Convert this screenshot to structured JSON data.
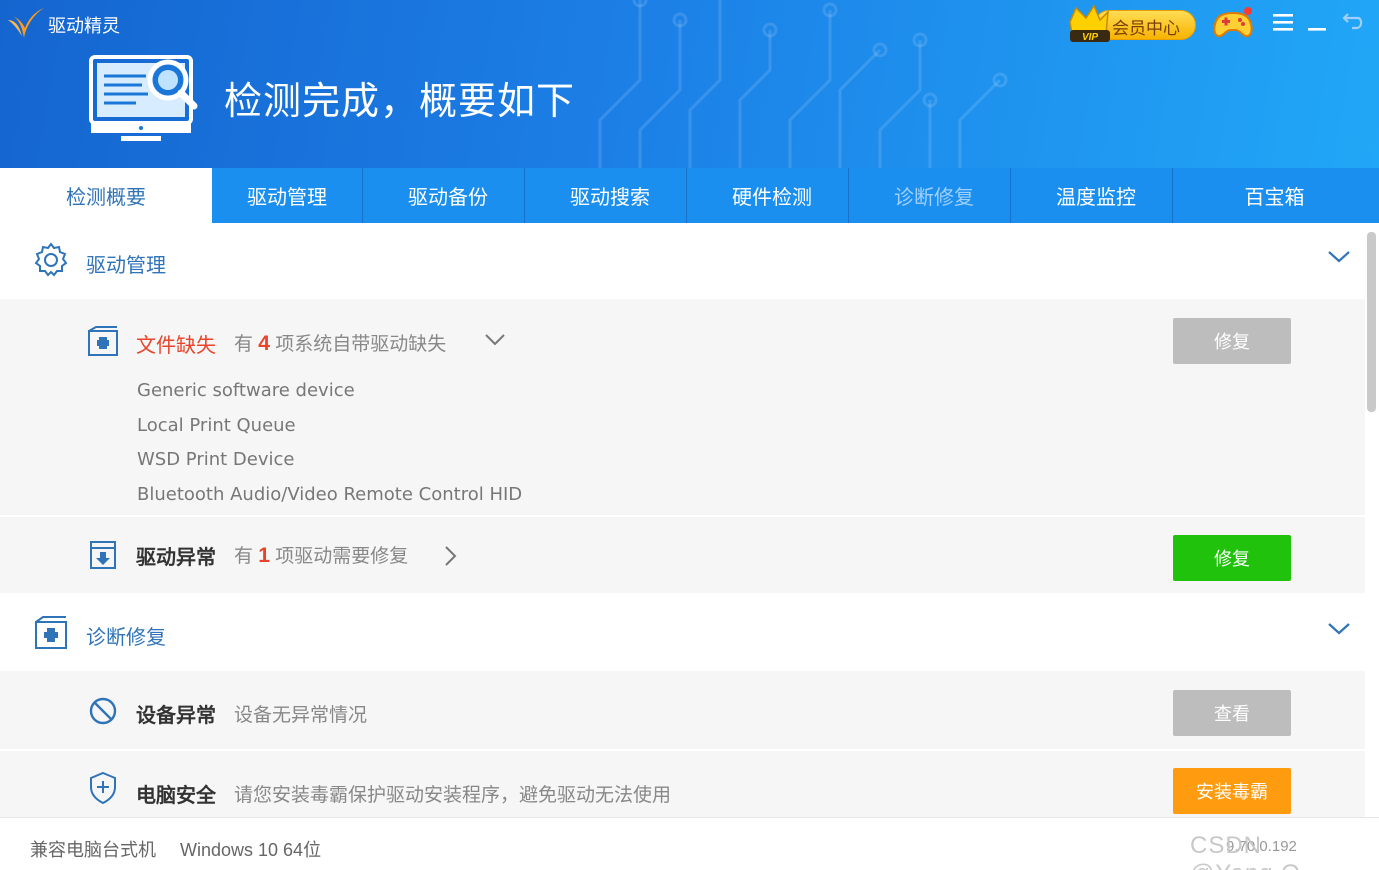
{
  "app": {
    "name": "驱动精灵"
  },
  "header": {
    "title": "检测完成，概要如下",
    "vip_badge": "VIP",
    "vip_label": "会员中心",
    "icons": [
      "logo-icon",
      "monitor-search-icon",
      "crown-icon",
      "game-icon",
      "menu-icon",
      "minimize-icon",
      "restore-icon"
    ]
  },
  "tabs": [
    {
      "label": "检测概要",
      "active": true
    },
    {
      "label": "驱动管理"
    },
    {
      "label": "驱动备份"
    },
    {
      "label": "驱动搜索"
    },
    {
      "label": "硬件检测"
    },
    {
      "label": "诊断修复"
    },
    {
      "label": "温度监控"
    },
    {
      "label": "百宝箱"
    }
  ],
  "driver_section": {
    "title": "驱动管理",
    "missing": {
      "title": "文件缺失",
      "desc_prefix": "有",
      "count": "4",
      "desc_suffix": "项系统自带驱动缺失",
      "button": "修复",
      "devices": [
        "Generic software device",
        "Local Print Queue",
        "WSD Print Device",
        "Bluetooth Audio/Video Remote Control HID"
      ]
    },
    "abnormal": {
      "title": "驱动异常",
      "desc_prefix": "有",
      "count": "1",
      "desc_suffix": "项驱动需要修复",
      "button": "修复"
    }
  },
  "diagnose_section": {
    "title": "诊断修复",
    "device": {
      "title": "设备异常",
      "desc": "设备无异常情况",
      "button": "查看"
    },
    "security": {
      "title": "电脑安全",
      "desc": "请您安装毒霸保护驱动安装程序，避免驱动无法使用",
      "button": "安装毒霸"
    }
  },
  "status": {
    "machine": "兼容电脑台式机",
    "os": "Windows 10 64位",
    "version": "9.70.0.192",
    "watermark": "CSDN @Yang.O"
  },
  "colors": {
    "header_start": "#1565cf",
    "header_end": "#21a7f7",
    "tabbar": "#1b8ff0",
    "accent": "#2f73b8",
    "warn": "#e8442a",
    "green": "#20c20c",
    "orange": "#ff9b0f"
  }
}
